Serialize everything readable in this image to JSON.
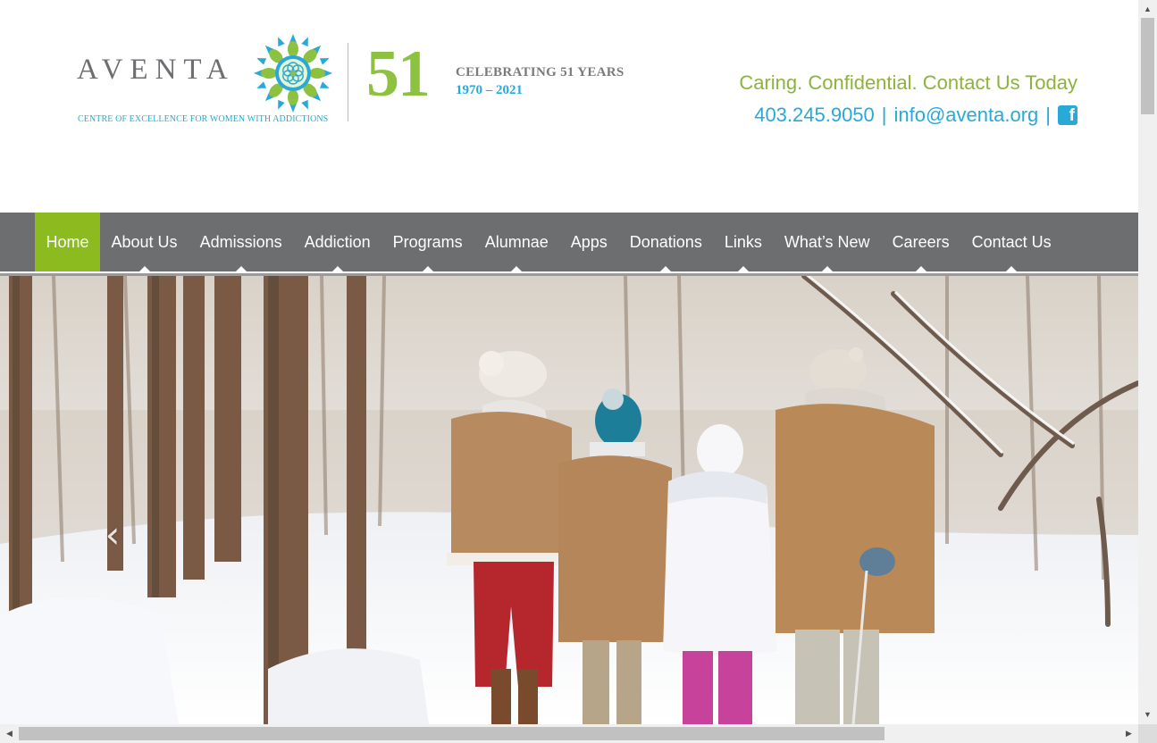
{
  "brand": {
    "name": "AVENTA",
    "tagline": "CENTRE OF EXCELLENCE FOR WOMEN WITH ADDICTIONS",
    "anniversary_number": "51",
    "anniversary_title": "CELEBRATING 51 YEARS",
    "anniversary_years": "1970 – 2021",
    "colors": {
      "green": "#8cc23f",
      "blue": "#29a9d8",
      "grey": "#6d6e71"
    }
  },
  "contact": {
    "tagline": "Caring. Confidential. Contact Us Today",
    "phone": "403.245.9050",
    "separator": "|",
    "email": "info@aventa.org",
    "facebook_icon": "facebook-icon"
  },
  "nav": {
    "background": "#6d6e70",
    "active_color": "#8cbb1f",
    "items": [
      {
        "label": "Home"
      },
      {
        "label": "About Us"
      },
      {
        "label": "Admissions"
      },
      {
        "label": "Addiction"
      },
      {
        "label": "Programs"
      },
      {
        "label": "Alumnae"
      },
      {
        "label": "Apps"
      },
      {
        "label": "Donations"
      },
      {
        "label": "Links"
      },
      {
        "label": "What’s New"
      },
      {
        "label": "Careers"
      },
      {
        "label": "Contact Us"
      }
    ]
  },
  "hero": {
    "prev_icon": "chevron-left-icon",
    "prev_glyph": "‹"
  },
  "scrollbars": {
    "up_glyph": "▲",
    "down_glyph": "▼",
    "left_glyph": "◀",
    "right_glyph": "▶"
  }
}
